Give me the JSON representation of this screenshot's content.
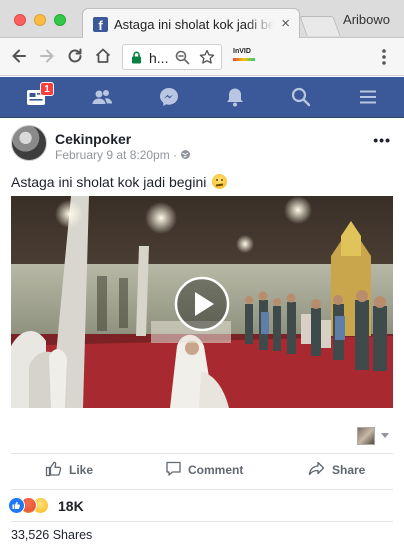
{
  "browser": {
    "tab_title": "Astaga ini sholat kok jadi begini",
    "tab_close": "×",
    "profile_name": "Aribowo",
    "address_text": "h...",
    "extension_label": "InVID"
  },
  "fb_nav": {
    "notification_count": "1",
    "items": [
      "feed-icon",
      "friends-icon",
      "messenger-icon",
      "bell-icon",
      "search-icon",
      "menu-icon"
    ]
  },
  "post": {
    "author": "Cekinpoker",
    "timestamp": "February 9 at 8:20pm",
    "separator": " · ",
    "more": "•••",
    "text": "Astaga ini sholat kok jadi begini",
    "actions": {
      "like": "Like",
      "comment": "Comment",
      "share": "Share"
    },
    "reaction_count": "18K",
    "shares": "33,526 Shares"
  },
  "colors": {
    "fb_blue": "#3b5998",
    "like_blue": "#2078f4",
    "badge_red": "#fa3e3e"
  }
}
